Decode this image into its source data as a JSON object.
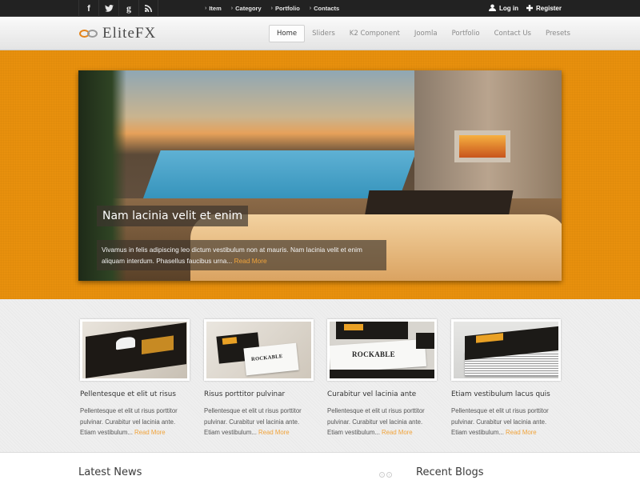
{
  "topbar": {
    "social": [
      {
        "icon": "facebook-icon",
        "glyph": "f"
      },
      {
        "icon": "twitter-icon",
        "glyph": "🐦"
      },
      {
        "icon": "google-icon",
        "glyph": "g"
      },
      {
        "icon": "rss-icon",
        "glyph": "≋"
      }
    ],
    "menu": [
      {
        "label": "Item"
      },
      {
        "label": "Category"
      },
      {
        "label": "Portfolio"
      },
      {
        "label": "Contacts"
      }
    ],
    "chevron": "›",
    "login": {
      "label": "Log in",
      "icon": "👤"
    },
    "register": {
      "label": "Register",
      "icon": "✚"
    }
  },
  "header": {
    "logo_text": "EliteFX",
    "nav": [
      {
        "label": "Home",
        "active": true
      },
      {
        "label": "Sliders"
      },
      {
        "label": "K2 Component"
      },
      {
        "label": "Joomla"
      },
      {
        "label": "Portfolio"
      },
      {
        "label": "Contact Us"
      },
      {
        "label": "Presets"
      }
    ]
  },
  "slideshow": {
    "title": "Nam lacinia velit et enim",
    "body": "Vivamus in felis adipiscing leo dictum vestibulum non at mauris. Nam lacinia velit et enim aliquam interdum. Phasellus faucibus urna... ",
    "read_more": "Read More"
  },
  "features": [
    {
      "title": "Pellentesque et elit ut risus",
      "text": "Pellentesque et elit ut risus porttitor pulvinar. Curabitur vel lacinia ante. Etiam vestibulum... ",
      "read_more": "Read More"
    },
    {
      "title": "Risus porttitor pulvinar",
      "text": "Pellentesque et elit ut risus porttitor pulvinar. Curabitur vel lacinia ante. Etiam vestibulum... ",
      "read_more": "Read More",
      "thumb_word": "ROCKABLE"
    },
    {
      "title": "Curabitur vel lacinia ante",
      "text": "Pellentesque et elit ut risus porttitor pulvinar. Curabitur vel lacinia ante. Etiam vestibulum... ",
      "read_more": "Read More",
      "thumb_word": "ROCKABLE"
    },
    {
      "title": "Etiam vestibulum lacus quis",
      "text": "Pellentesque et elit ut risus porttitor pulvinar. Curabitur vel lacinia ante. Etiam vestibulum... ",
      "read_more": "Read More"
    }
  ],
  "bottom": {
    "latest_news": "Latest News",
    "recent_blogs": "Recent Blogs",
    "prev": "‹",
    "next": "›"
  },
  "colors": {
    "accent_orange": "#e8900d",
    "read_more": "#f0a33a",
    "topbar": "#222222"
  }
}
